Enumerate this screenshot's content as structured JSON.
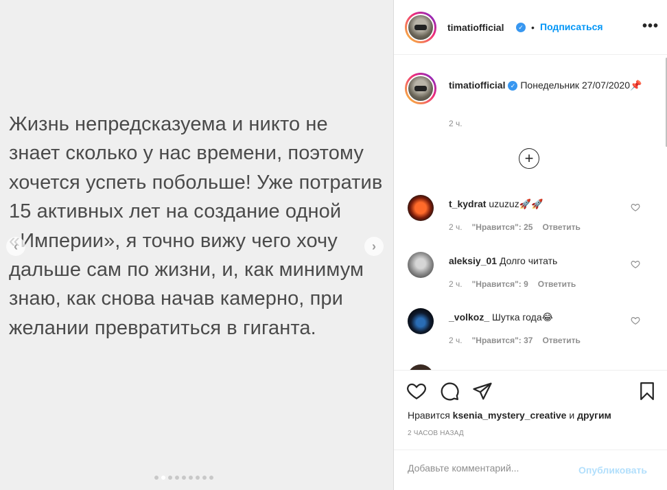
{
  "media": {
    "text": "Жизнь непредсказуема и никто не\nзнает сколько у нас времени, поэтому\nхочется успеть побольше! Уже потратив\n15 активных лет на создание одной\n«Империи», я точно вижу чего хочу\nдальше сам по жизни, и, как минимум\nзнаю, как снова начав камерно, при\nжелании превратиться в гиганта.",
    "prev_icon": "chevron-left-icon",
    "next_icon": "chevron-right-icon",
    "dots": 9,
    "active_dot": 1
  },
  "header": {
    "username": "timatiofficial",
    "dot": "•",
    "follow_label": "Подписаться",
    "more_label": "•••"
  },
  "caption": {
    "username": "timatiofficial",
    "text": "Понедельник 27/07/2020📌",
    "time": "2 ч.",
    "load_more_icon": "plus-circle-icon"
  },
  "comments": [
    {
      "username": "t_kydrat",
      "text": "uzuzuz🚀🚀",
      "time": "2 ч.",
      "likes": "\"Нравится\": 25",
      "reply": "Ответить"
    },
    {
      "username": "aleksiy_01",
      "text": "Долго читать",
      "time": "2 ч.",
      "likes": "\"Нравится\": 9",
      "reply": "Ответить"
    },
    {
      "username": "_volkoz_",
      "text": "Шутка года😂",
      "time": "2 ч.",
      "likes": "\"Нравится\": 37",
      "reply": "Ответить"
    }
  ],
  "actions": {
    "likes_prefix": "Нравится",
    "likes_user": "ksenia_mystery_creative",
    "likes_and": "и",
    "likes_others": "другим",
    "time_ago": "2 ЧАСОВ НАЗАД"
  },
  "comment_box": {
    "placeholder": "Добавьте комментарий...",
    "publish_label": "Опубликовать"
  },
  "colors": {
    "accent": "#0095f6",
    "verified": "#3897f0",
    "muted": "#8e8e8e"
  }
}
